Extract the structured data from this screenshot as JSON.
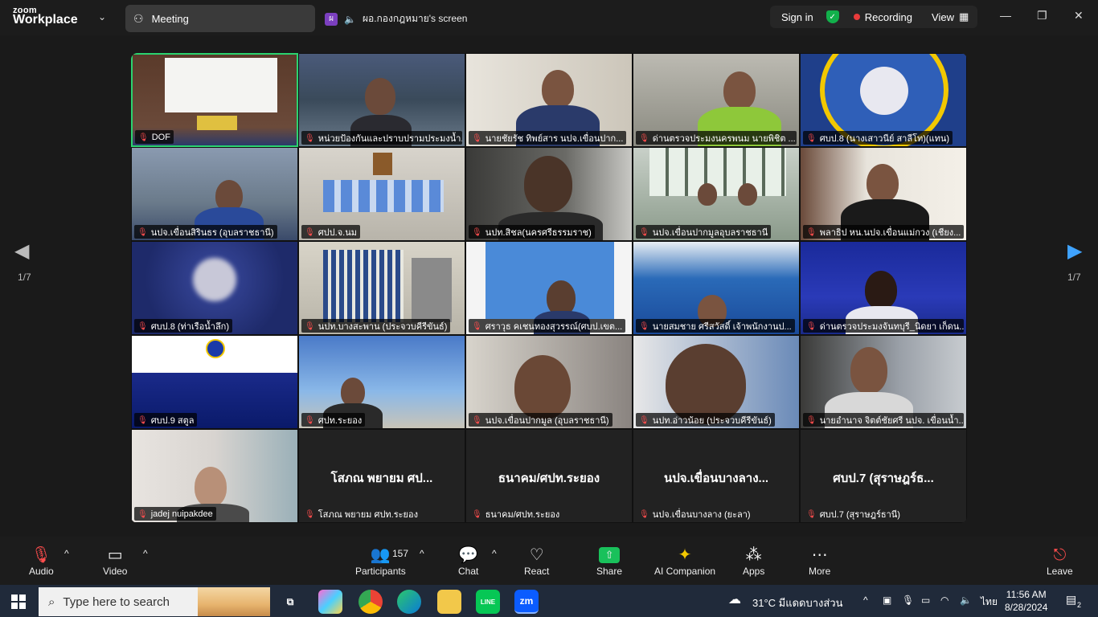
{
  "titlebar": {
    "brand_small": "zoom",
    "brand_big": "Workplace",
    "meeting_tab": "Meeting",
    "share_badge": "ผ",
    "share_label": "ผอ.กองกฎหมาย's screen",
    "signin": "Sign in",
    "recording": "Recording",
    "view": "View"
  },
  "stage": {
    "page_left": "1/7",
    "page_right": "1/7"
  },
  "tiles": [
    {
      "name": "DOF"
    },
    {
      "name": "หน่วยป้องกันและปราบปรามประมงน้ำ..."
    },
    {
      "name": "นายชัยรัช ทิพย์สาร นปจ.เขื่อนปาก..."
    },
    {
      "name": "ด่านตรวจประมงนครพนม นายพิชิต ..."
    },
    {
      "name": "ศบป.8 (นางเสาวนีย์ สาลีโท)(แทน)"
    },
    {
      "name": "นปจ.เขื่อนสิรินธร (อุบลราชธานี)"
    },
    {
      "name": "ศปป.จ.นม"
    },
    {
      "name": "นปท.สิชล(นครศรีธรรมราช)"
    },
    {
      "name": "นปจ.เขื่อนปากมูลอุบลราชธานี"
    },
    {
      "name": "พลาธิป หน.นปจ.เขื่อนแม่กวง (เชียง..."
    },
    {
      "name": "ศบป.8 (ท่าเรือน้ำลึก)"
    },
    {
      "name": "นปท.บางสะพาน (ประจวบคีรีขันธ์)"
    },
    {
      "name": "ศราวุธ คเชนทองสุวรรณ์(ศบป.เขต..."
    },
    {
      "name": "นายสมชาย ศรีสวัสดิ์ เจ้าพนักงานป..."
    },
    {
      "name": "ด่านตรวจประมงจันทบุรี_นิดยา เก็ดน..."
    },
    {
      "name": "ศบป.9 สตูล"
    },
    {
      "name": "ศปท.ระยอง"
    },
    {
      "name": "นปจ.เขื่อนปากมูล (อุบลราชธานี)"
    },
    {
      "name": "นปท.อ่าวน้อย (ประจวบคีรีขันธ์)"
    },
    {
      "name": "นายอำนาจ จิตต์ชัยศรี นปจ. เขื่อนน้ำ..."
    },
    {
      "name": "jadej nuipakdee"
    },
    {
      "name": "โสภณ พยายม ศปท.ระยอง",
      "big": "โสภณ พยายม ศป..."
    },
    {
      "name": "ธนาคม/ศปท.ระยอง",
      "big": "ธนาคม/ศปท.ระยอง"
    },
    {
      "name": "นปจ.เขื่อนบางลาง (ยะลา)",
      "big": "นปจ.เขื่อนบางลาง..."
    },
    {
      "name": "ศบป.7 (สุราษฎร์ธานี)",
      "big": "ศบป.7 (สุราษฎร์ธ..."
    }
  ],
  "toolbar": {
    "audio": "Audio",
    "video": "Video",
    "participants": "Participants",
    "participants_count": "157",
    "chat": "Chat",
    "react": "React",
    "share": "Share",
    "ai": "AI Companion",
    "apps": "Apps",
    "more": "More",
    "leave": "Leave"
  },
  "taskbar": {
    "search_placeholder": "Type here to search",
    "weather": "31°C  มีแดดบางส่วน",
    "lang": "ไทย",
    "time": "11:56 AM",
    "date": "8/28/2024",
    "notif_count": "2",
    "zoom_app": "zm"
  },
  "colors": {
    "active_border": "#2bd36f",
    "mic_off": "#ff4d4d",
    "recording_dot": "#e83b3b",
    "share_green": "#19c15b",
    "next_arrow": "#3fa3ff"
  }
}
